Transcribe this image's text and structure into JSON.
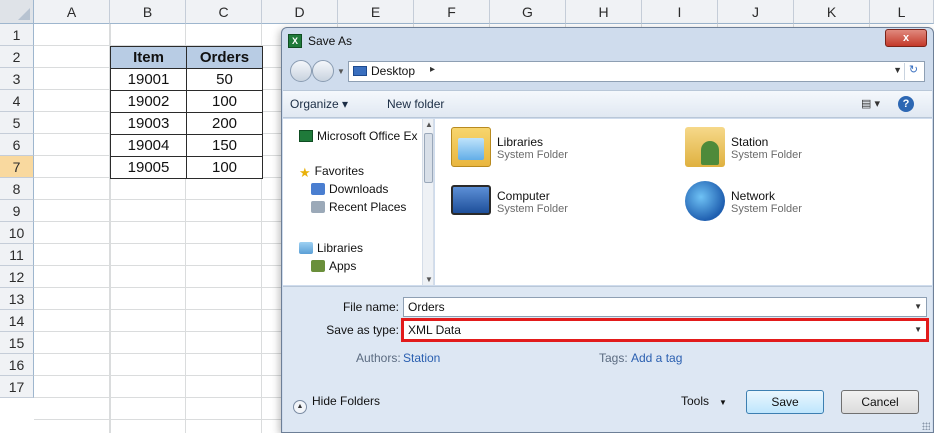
{
  "spreadsheet": {
    "columns": [
      "A",
      "B",
      "C",
      "D",
      "E",
      "F",
      "G",
      "H",
      "I",
      "J",
      "K",
      "L"
    ],
    "rows": [
      "1",
      "2",
      "3",
      "4",
      "5",
      "6",
      "7",
      "8",
      "9",
      "10",
      "11",
      "12",
      "13",
      "14",
      "15",
      "16",
      "17"
    ],
    "table": {
      "headers": [
        "Item",
        "Orders"
      ],
      "rows": [
        [
          "19001",
          "50"
        ],
        [
          "19002",
          "100"
        ],
        [
          "19003",
          "200"
        ],
        [
          "19004",
          "150"
        ],
        [
          "19005",
          "100"
        ]
      ]
    }
  },
  "dialog": {
    "title": "Save As",
    "close_label": "x",
    "address": {
      "location": "Desktop",
      "arrow": "▸"
    },
    "toolbar": {
      "organize": "Organize ▾",
      "new_folder": "New folder",
      "views": "▾",
      "help": "?"
    },
    "nav_pane": [
      {
        "label": "Microsoft Office Ex",
        "icon": "excel-icon"
      },
      {
        "label": "Favorites",
        "icon": "star-icon"
      },
      {
        "label": "Downloads",
        "icon": "downloads-folder-icon"
      },
      {
        "label": "Recent Places",
        "icon": "recent-places-icon"
      },
      {
        "label": "Libraries",
        "icon": "libraries-icon"
      },
      {
        "label": "Apps",
        "icon": "apps-icon"
      }
    ],
    "content_items": [
      {
        "name": "Libraries",
        "sub": "System Folder",
        "icon": "libraries-folder-icon"
      },
      {
        "name": "Station",
        "sub": "System Folder",
        "icon": "user-folder-icon"
      },
      {
        "name": "Computer",
        "sub": "System Folder",
        "icon": "computer-icon"
      },
      {
        "name": "Network",
        "sub": "System Folder",
        "icon": "network-icon"
      }
    ],
    "file_name_label": "File name:",
    "file_name_value": "Orders",
    "save_type_label": "Save as type:",
    "save_type_value": "XML Data",
    "authors_label": "Authors:",
    "authors_value": "Station",
    "tags_label": "Tags:",
    "tags_value": "Add a tag",
    "hide_folders": "Hide Folders",
    "tools": "Tools",
    "save_button": "Save",
    "cancel_button": "Cancel",
    "highlight_color": "#e21b1b"
  }
}
